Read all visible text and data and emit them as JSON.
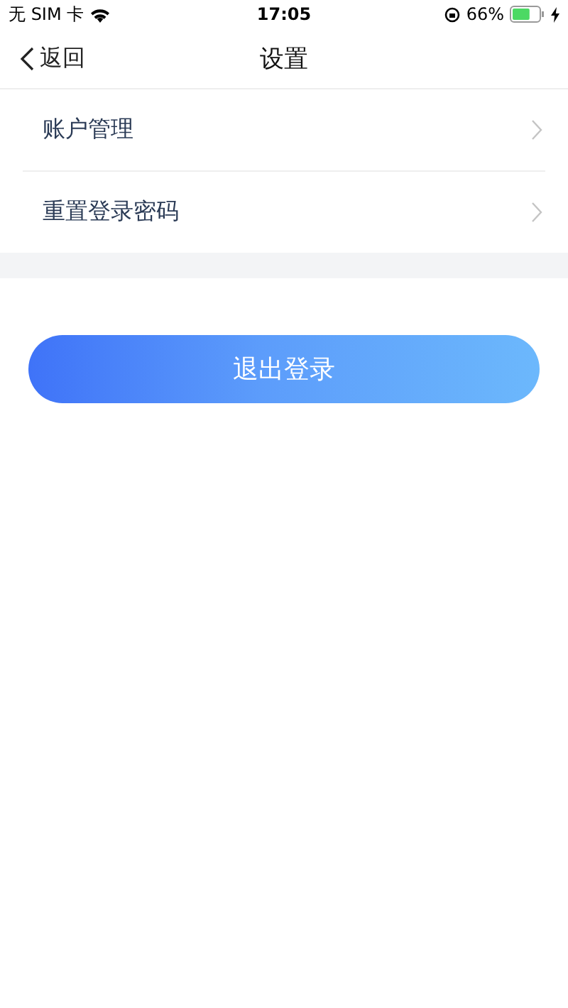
{
  "status_bar": {
    "carrier": "无 SIM 卡",
    "time": "17:05",
    "battery_percent": "66%",
    "charging": true
  },
  "nav_bar": {
    "back_label": "返回",
    "title": "设置"
  },
  "menu_items": [
    {
      "label": "账户管理"
    },
    {
      "label": "重置登录密码"
    }
  ],
  "logout_button": {
    "label": "退出登录"
  }
}
